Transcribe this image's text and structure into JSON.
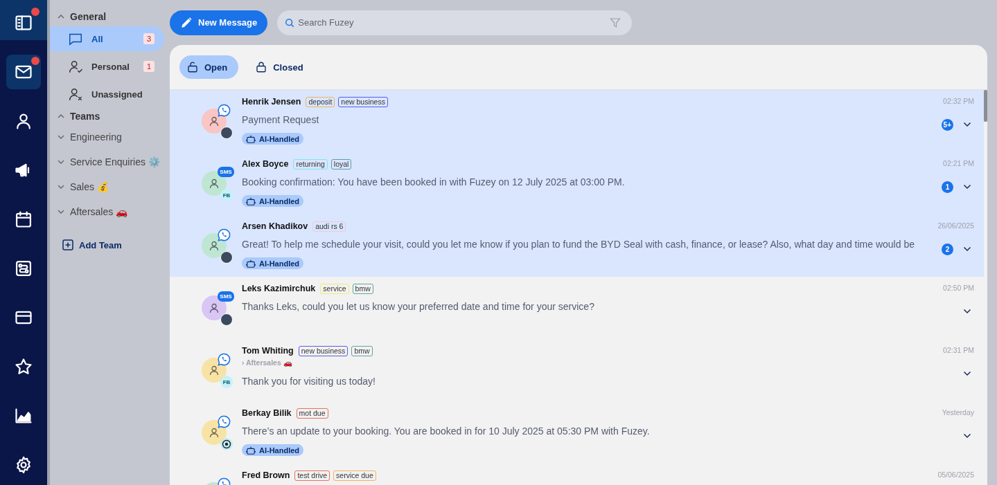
{
  "panel_toggle": {
    "dot": true
  },
  "rail": [
    {
      "selected": true,
      "dot": true
    },
    {
      "selected": false,
      "dot": false
    },
    {
      "selected": false,
      "dot": false
    },
    {
      "selected": false,
      "dot": false
    },
    {
      "selected": false,
      "dot": false
    },
    {
      "selected": false,
      "dot": false
    },
    {
      "selected": false,
      "dot": false
    },
    {
      "selected": false,
      "dot": false
    },
    {
      "selected": false,
      "dot": false
    }
  ],
  "new_message_button": "New Message",
  "search": {
    "placeholder": "Search Fuzey"
  },
  "sidebar": {
    "sections": [
      {
        "title": "General",
        "expanded": true,
        "items": [
          {
            "kind": "inbox",
            "label": "All",
            "count": "3",
            "selected": true
          },
          {
            "kind": "inbox",
            "label": "Personal",
            "count": "1",
            "selected": false
          },
          {
            "kind": "inbox",
            "label": "Unassigned",
            "selected": false
          }
        ]
      },
      {
        "title": "Teams",
        "expanded": true,
        "items": [
          {
            "kind": "team",
            "label": "Engineering",
            "expanded": false,
            "selected": false
          },
          {
            "kind": "team",
            "label": "Service Enquiries ⚙️",
            "expanded": false,
            "selected": false
          },
          {
            "kind": "team",
            "label": "Sales 💰",
            "expanded": false,
            "selected": false
          },
          {
            "kind": "team",
            "label": "Aftersales 🚗",
            "expanded": false,
            "selected": false
          }
        ]
      }
    ],
    "add_team": "Add Team"
  },
  "status_tabs": [
    {
      "label": "Open",
      "selected": true
    },
    {
      "label": "Closed",
      "selected": false
    }
  ],
  "conversations": [
    {
      "name": "Henrik Jensen",
      "tags": [
        {
          "label": "deposit",
          "color": "#f2b45c"
        },
        {
          "label": "new business",
          "color": "#5b5bef"
        }
      ],
      "message": "Payment Request",
      "ai_badge": "AI-Handled",
      "time": "02:32 PM",
      "unread": "5+",
      "selected": true,
      "color": "#f9c5c5",
      "channel": {
        "kind": "whatsapp"
      },
      "agent": {
        "kind": "photo"
      }
    },
    {
      "name": "Alex Boyce",
      "tags": [
        {
          "label": "returning",
          "color": "#80e6f0"
        },
        {
          "label": "loyal",
          "color": "#5a9fa8"
        }
      ],
      "message": "Booking confirmation: You have been booked in with Fuzey on 12 July 2025 at 03:00 PM.",
      "ai_badge": "AI-Handled",
      "time": "02:21 PM",
      "unread": "1",
      "selected": true,
      "color": "#bfe6d3",
      "channel": {
        "kind": "sms",
        "label": "SMS"
      },
      "agent": {
        "kind": "initials",
        "label": "FB"
      }
    },
    {
      "name": "Arsen Khadikov",
      "tags": [
        {
          "label": "audi rs 6",
          "color": "#f5c7d2"
        }
      ],
      "message": "Great! To help me schedule your visit, could you let me know if you plan to fund the BYD Seal with cash, finance, or lease? Also, what day and time would be",
      "ai_badge": "AI-Handled",
      "time": "26/06/2025",
      "unread": "2",
      "selected": true,
      "color": "#bfe6d3",
      "channel": {
        "kind": "whatsapp"
      },
      "agent": {
        "kind": "photo"
      }
    },
    {
      "name": "Leks Kazimirchuk",
      "tags": [
        {
          "label": "service",
          "color": "#efec6c"
        },
        {
          "label": "bmw",
          "color": "#5aa89f"
        }
      ],
      "message": "Thanks Leks, could you let us know your preferred date and time for your service?",
      "time": "02:50 PM",
      "selected": false,
      "color": "#d9c6f5",
      "channel": {
        "kind": "sms",
        "label": "SMS"
      },
      "agent": {
        "kind": "photo"
      }
    },
    {
      "name": "Tom Whiting",
      "tags": [
        {
          "label": "new business",
          "color": "#5b5bef"
        },
        {
          "label": "bmw",
          "color": "#5aa89f"
        }
      ],
      "team": "› Aftersales 🚗",
      "message": "Thank you for visiting us today!",
      "time": "02:31 PM",
      "selected": false,
      "color": "#f8e3a6",
      "channel": {
        "kind": "whatsapp"
      },
      "agent": {
        "kind": "initials",
        "label": "FB"
      }
    },
    {
      "name": "Berkay Bilik",
      "tags": [
        {
          "label": "mot due",
          "color": "#ef6d60"
        }
      ],
      "message": "There’s an update to your booking. You are booked in for 10 July 2025 at 05:30 PM with Fuzey.",
      "ai_badge": "AI-Handled",
      "time": "Yesterday",
      "selected": false,
      "color": "#f8e3a6",
      "channel": {
        "kind": "whatsapp"
      },
      "agent": {
        "kind": "target"
      }
    },
    {
      "name": "Fred Brown",
      "tags": [
        {
          "label": "test drive",
          "color": "#ef6d60"
        },
        {
          "label": "service due",
          "color": "#f2b45c"
        }
      ],
      "time": "05/06/2025",
      "selected": false,
      "color": "#bfe6d3",
      "channel": {
        "kind": "whatsapp"
      },
      "agent": {
        "kind": "none"
      }
    }
  ]
}
